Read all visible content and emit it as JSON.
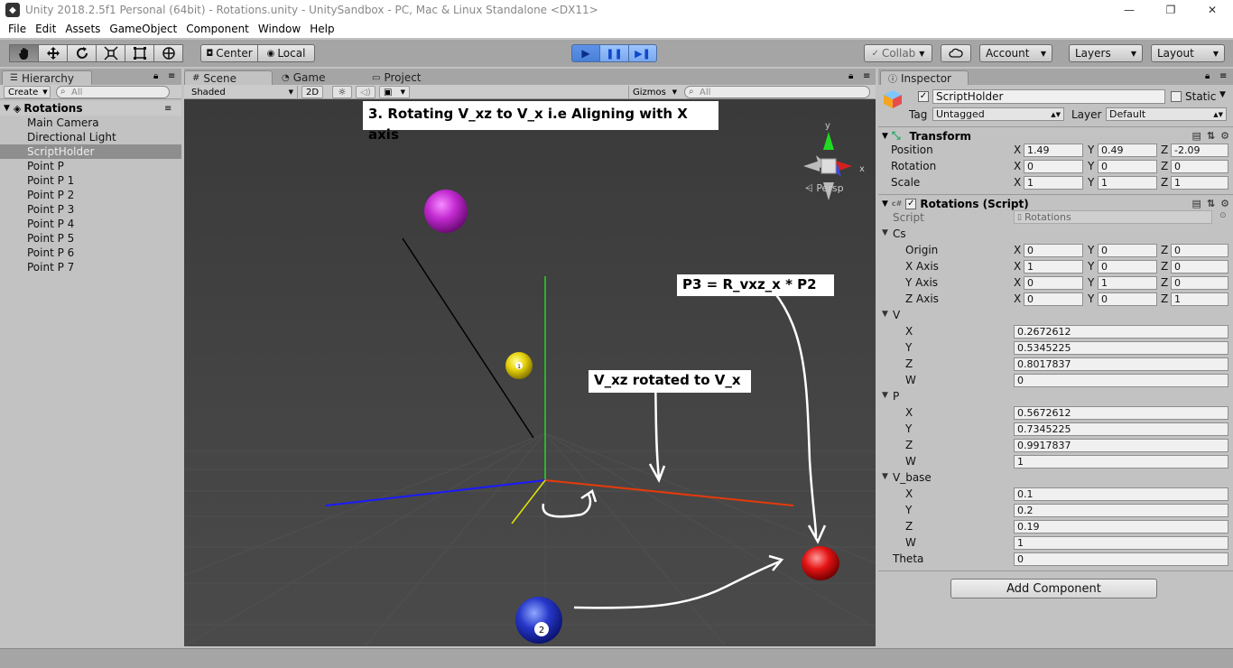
{
  "window": {
    "title": "Unity 2018.2.5f1 Personal (64bit) - Rotations.unity - UnitySandbox - PC, Mac & Linux Standalone <DX11>",
    "buttons": [
      "—",
      "❐",
      "✕"
    ]
  },
  "menu": [
    "File",
    "Edit",
    "Assets",
    "GameObject",
    "Component",
    "Window",
    "Help"
  ],
  "toolbar": {
    "tools": [
      "hand-tool",
      "move-tool",
      "rotate-tool",
      "scale-tool",
      "rect-tool",
      "transform-tool"
    ],
    "pivot": "Center",
    "space": "Local",
    "play": "▶",
    "pause": "❚❚",
    "step": "▶❚",
    "collab": "Collab",
    "account": "Account",
    "layers": "Layers",
    "layout": "Layout"
  },
  "hierarchy": {
    "tab": "Hierarchy",
    "create": "Create",
    "search_placeholder": "All",
    "root": "Rotations",
    "items": [
      "Main Camera",
      "Directional Light",
      "ScriptHolder",
      "Point P",
      "Point P 1",
      "Point P 2",
      "Point P 3",
      "Point P 4",
      "Point P 5",
      "Point P 6",
      "Point P 7"
    ],
    "selected": "ScriptHolder"
  },
  "scene": {
    "tabs": [
      "Scene",
      "Game",
      "Project"
    ],
    "shading": "Shaded",
    "mode2d": "2D",
    "gizmos": "Gizmos",
    "search_placeholder": "All",
    "persp": "Persp",
    "gizmo_axes": {
      "y": "y",
      "x": "x"
    },
    "captions": {
      "title": "3. Rotating V_xz to V_x i.e Aligning with X axis",
      "p3": "P3 = R_vxz_x * P2",
      "vxz": "V_xz rotated to V_x"
    },
    "ball_labels": {
      "yellow": "1",
      "blue": "2"
    }
  },
  "inspector": {
    "tab": "Inspector",
    "object_name": "ScriptHolder",
    "static_label": "Static",
    "tag_label": "Tag",
    "tag_value": "Untagged",
    "layer_label": "Layer",
    "layer_value": "Default",
    "transform": {
      "title": "Transform",
      "position": {
        "label": "Position",
        "x": "1.49",
        "y": "0.49",
        "z": "-2.09"
      },
      "rotation": {
        "label": "Rotation",
        "x": "0",
        "y": "0",
        "z": "0"
      },
      "scale": {
        "label": "Scale",
        "x": "1",
        "y": "1",
        "z": "1"
      }
    },
    "script_component": {
      "title": "Rotations (Script)",
      "script_label": "Script",
      "script_value": "Rotations",
      "cs_label": "Cs",
      "cs_rows": [
        {
          "label": "Origin",
          "x": "0",
          "y": "0",
          "z": "0"
        },
        {
          "label": "X Axis",
          "x": "1",
          "y": "0",
          "z": "0"
        },
        {
          "label": "Y Axis",
          "x": "0",
          "y": "1",
          "z": "0"
        },
        {
          "label": "Z Axis",
          "x": "0",
          "y": "0",
          "z": "1"
        }
      ],
      "v_label": "V",
      "v": {
        "X": "0.2672612",
        "Y": "0.5345225",
        "Z": "0.8017837",
        "W": "0"
      },
      "p_label": "P",
      "p": {
        "X": "0.5672612",
        "Y": "0.7345225",
        "Z": "0.9917837",
        "W": "1"
      },
      "vbase_label": "V_base",
      "vbase": {
        "X": "0.1",
        "Y": "0.2",
        "Z": "0.19",
        "W": "1"
      },
      "theta_label": "Theta",
      "theta": "0"
    },
    "add_component": "Add Component"
  },
  "axis_letters": {
    "x": "X",
    "y": "Y",
    "z": "Z",
    "w": "W"
  }
}
